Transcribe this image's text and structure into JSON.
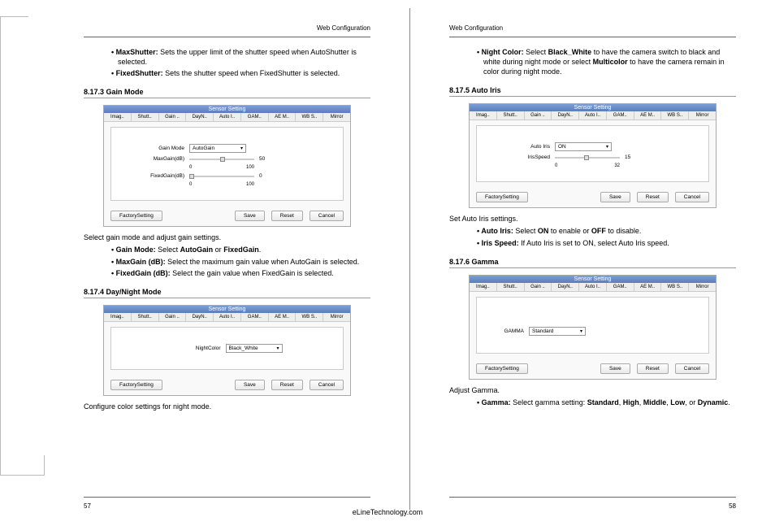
{
  "hdr": "Web Configuration",
  "site": "eLineTechnology.com",
  "pgL": "57",
  "pgR": "58",
  "panelTitle": "Sensor Setting",
  "tabs": [
    "Imag..",
    "Shutt..",
    "Gain ..",
    "DayN..",
    "Auto I..",
    "GAM..",
    "AE M..",
    "WB S..",
    "Mirror"
  ],
  "btns": {
    "factory": "FactorySetting",
    "save": "Save",
    "reset": "Reset",
    "cancel": "Cancel"
  },
  "L": {
    "bul1a": "MaxShutter:",
    "bul1b": " Sets the upper limit of the shutter speed when AutoShutter is selected.",
    "bul2a": "FixedShutter:",
    "bul2b": " Sets the shutter speed when FixedShutter is selected.",
    "s1": "8.17.3 Gain Mode",
    "gain": {
      "l1": "Gain Mode",
      "v1": "AutoGain",
      "l2": "MaxGain(dB)",
      "v2": "50",
      "r2a": "0",
      "r2b": "100",
      "l3": "FixedGain(dB)",
      "v3": "0",
      "r3a": "0",
      "r3b": "100"
    },
    "cap1": "Select gain mode and adjust gain settings.",
    "b3a": "Gain Mode:",
    "b3b": " Select ",
    "b3c": "AutoGain",
    "b3d": " or ",
    "b3e": "FixedGain",
    "b3f": ".",
    "b4a": "MaxGain (dB):",
    "b4b": " Select the maximum gain value when AutoGain is selected.",
    "b5a": "FixedGain (dB):",
    "b5b": " Select the gain value when FixedGain is selected.",
    "s2": "8.17.4 Day/Night Mode",
    "night": {
      "l": "NightColor",
      "v": "Black_White"
    },
    "cap2": "Configure color settings for night mode."
  },
  "R": {
    "b1a": "Night Color:",
    "b1b": " Select ",
    "b1c": "Black_White",
    "b1d": " to have the camera switch to black and white during night mode or select ",
    "b1e": "Multicolor",
    "b1f": " to have the camera remain in color during night mode.",
    "s1": "8.17.5 Auto Iris",
    "iris": {
      "l1": "Auto Iris",
      "v1": "ON",
      "l2": "IrisSpeed",
      "v2": "15",
      "r2a": "0",
      "r2b": "32"
    },
    "cap1": "Set Auto Iris settings.",
    "b2a": "Auto Iris:",
    "b2b": " Select ",
    "b2c": "ON",
    "b2d": " to enable or ",
    "b2e": "OFF",
    "b2f": " to disable.",
    "b3a": "Iris Speed:",
    "b3b": " If Auto Iris is set to ON, select Auto Iris speed.",
    "s2": "8.17.6 Gamma",
    "gamma": {
      "l": "GAMMA",
      "v": "Standard"
    },
    "cap2": "Adjust Gamma.",
    "b4a": "Gamma:",
    "b4b": " Select gamma setting: ",
    "b4c": "Standard",
    "b4d": ", ",
    "b4e": "High",
    "b4f": ", ",
    "b4g": "Middle",
    "b4h": ", ",
    "b4i": "Low",
    "b4j": ", or ",
    "b4k": "Dynamic",
    "b4l": "."
  }
}
